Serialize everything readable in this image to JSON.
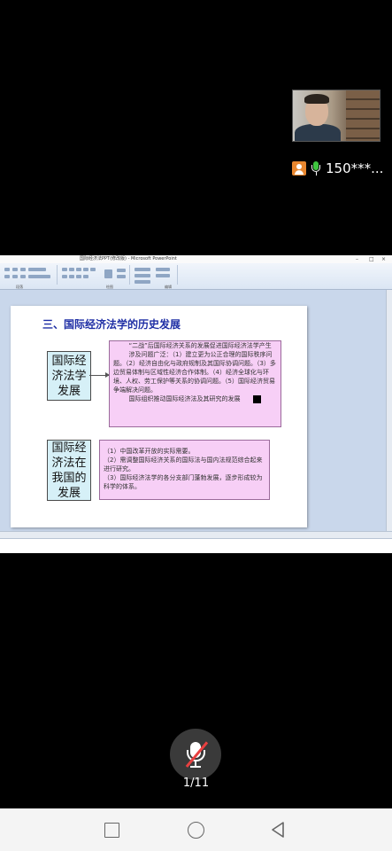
{
  "participant": {
    "name": "150***..."
  },
  "ppt": {
    "window_title": "国际经济法PPT(修改版) - Microsoft PowerPoint",
    "ribbon_groups": [
      "段落",
      "绘图",
      "编辑"
    ]
  },
  "slide": {
    "title": "三、国际经济法学的历史发展",
    "label_intl": "国际经济法学发展",
    "content_intl": [
      "“二战”后国际经济关系的发展促进国际经济法学产生",
      "涉及问题广泛：（1）建立更为公正合理的国际秩序问题。（2）经济自由化与政府规制及其国际协调问题。（3）多边贸易体制与区域性经济合作体制。（4）经济全球化与环境、人权、劳工保护等关系的协调问题。（5）国际经济贸易争端解决问题。",
      "国际组织推动国际经济法及其研究的发展"
    ],
    "label_china": "国际经济法在我国的发展",
    "content_china": [
      "（1）中国改革开放的实际需要。",
      "（2）需调整国际经济关系的国际法与国内法规范综合起来进行研究。",
      "（3）国际经济法学的各分支部门蓬勃发展，逐步形成较为科学的体系。"
    ]
  },
  "controls": {
    "page_indicator": "1/11",
    "mic_state": "muted"
  }
}
